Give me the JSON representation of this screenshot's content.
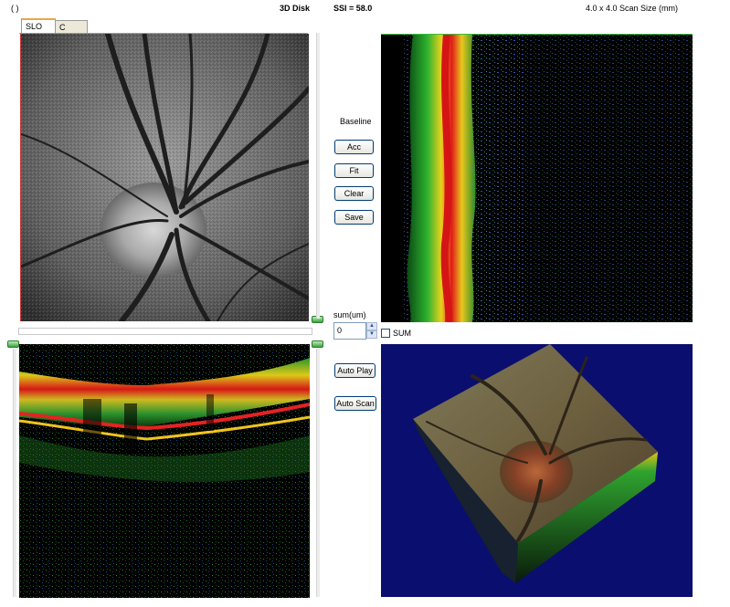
{
  "header": {
    "left_marker": "( )",
    "title": "3D Disk",
    "ssi": "SSI = 58.0",
    "scan_size": "4.0 x 4.0 Scan Size (mm)"
  },
  "tabs": [
    {
      "label": "SLO",
      "active": true
    },
    {
      "label": "C Scan",
      "active": false
    }
  ],
  "controls": {
    "baseline_label": "Baseline",
    "buttons": [
      "Acc",
      "Fit",
      "Clear",
      "Save"
    ],
    "sum_label": "sum(um)",
    "sum_value": "0",
    "sum_checkbox_label": "SUM",
    "auto_play_label": "Auto Play",
    "auto_scan_label": "Auto Scan"
  },
  "colors": {
    "oct_red": "#e11b1b",
    "oct_yellow": "#f2d21a",
    "oct_green": "#27b427",
    "oct_blue": "#3246c8",
    "volume_bg": "#0a0e6e",
    "thumb_green": "#3fa23f"
  }
}
